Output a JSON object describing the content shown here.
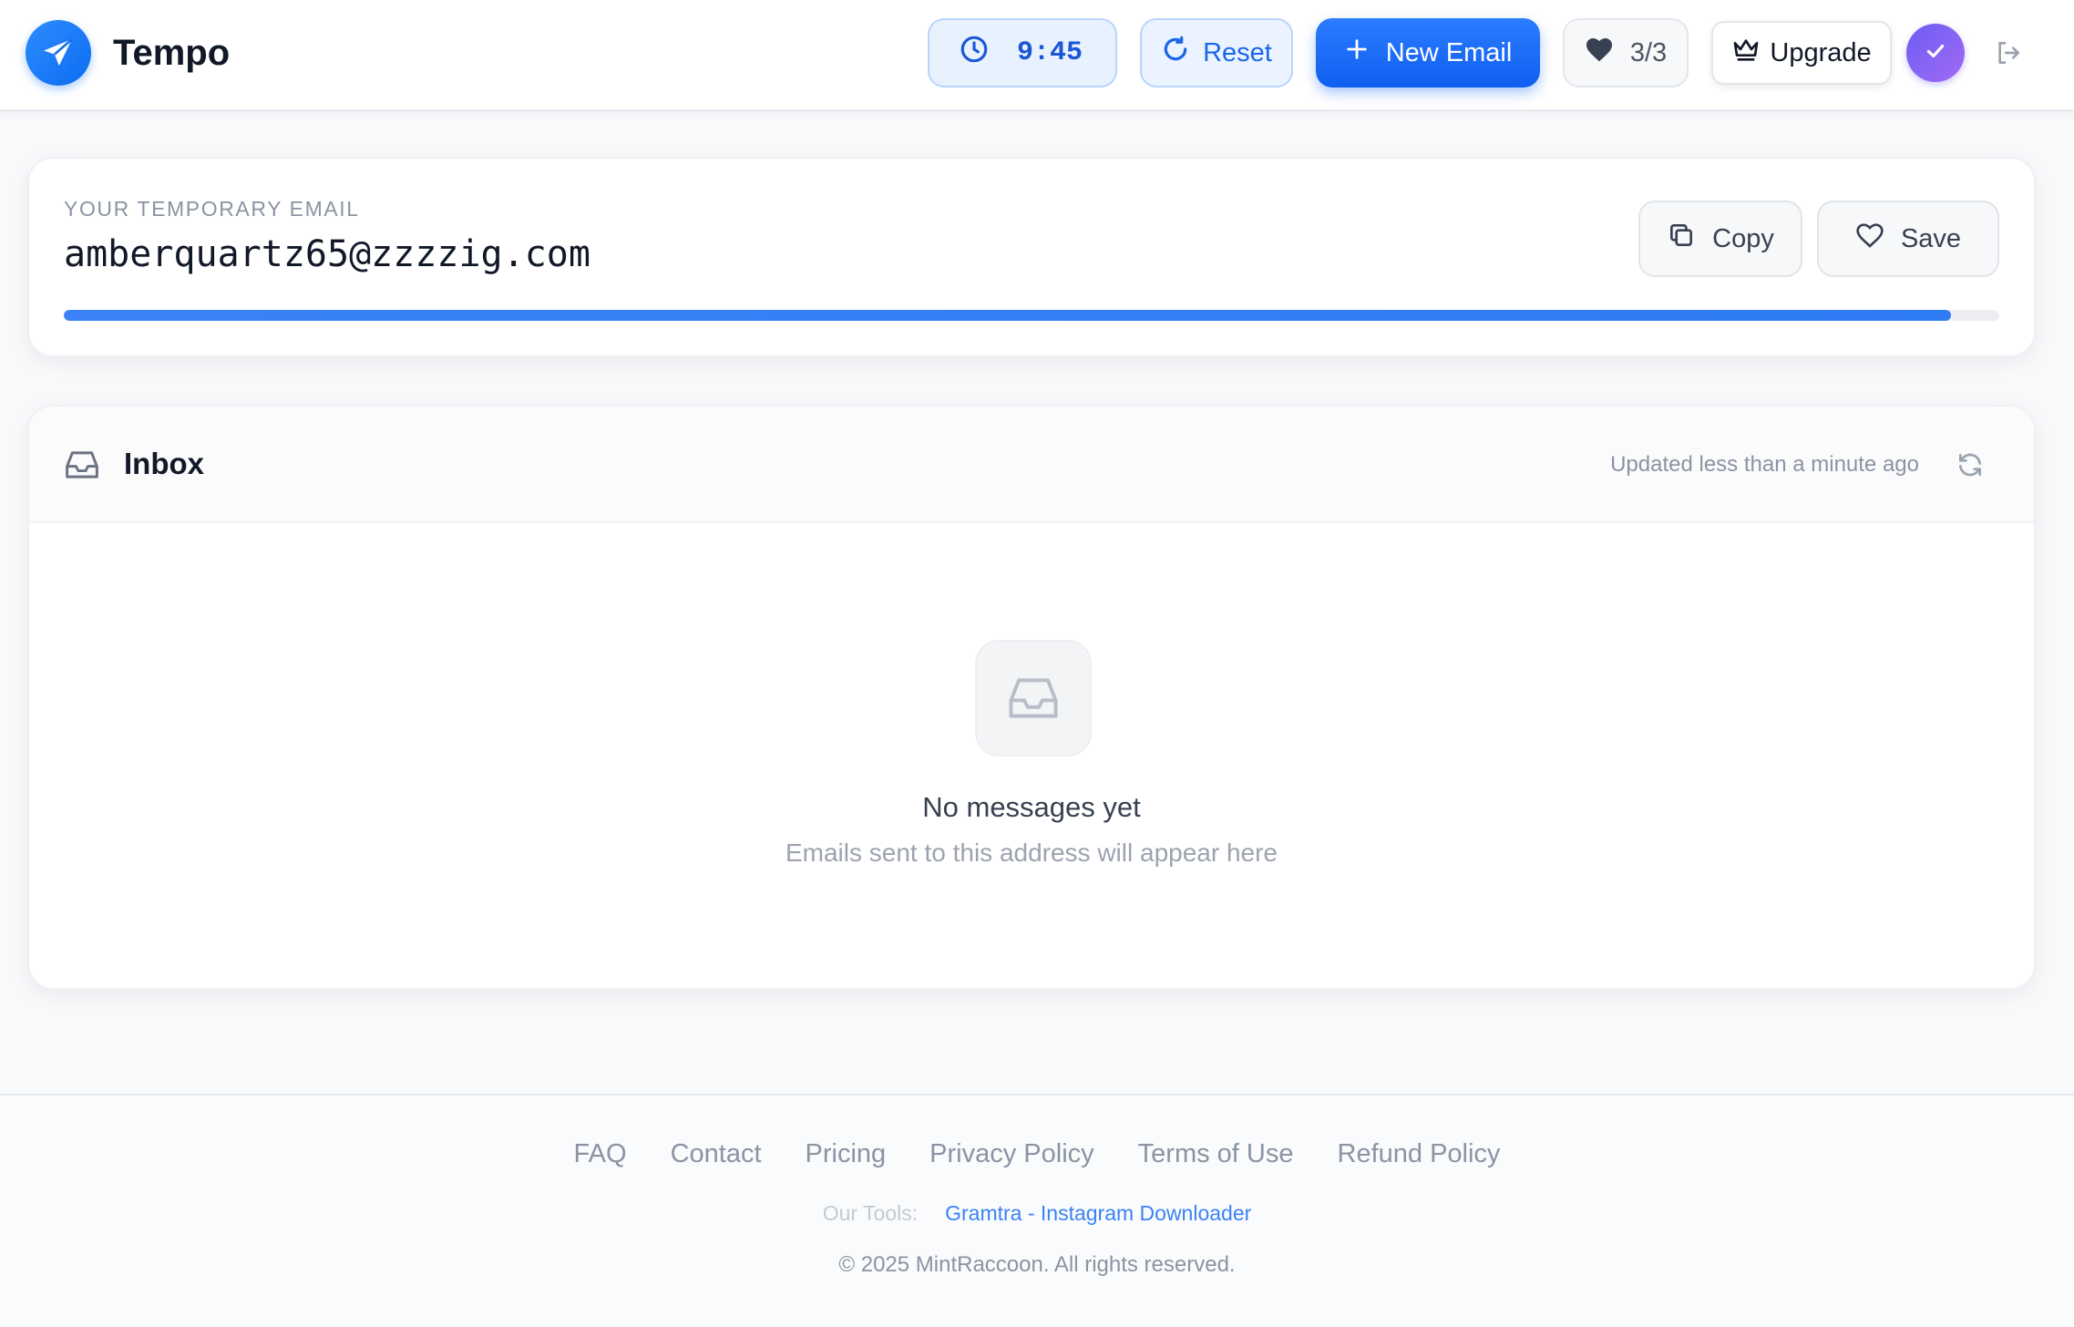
{
  "header": {
    "brand": "Tempo",
    "timer": "9:45",
    "reset_label": "Reset",
    "new_email_label": "New Email",
    "favorites_count": "3/3",
    "upgrade_label": "Upgrade",
    "icons": {
      "logo": "paper-plane-icon",
      "timer": "clock-icon",
      "reset": "rotate-icon",
      "new": "plus-icon",
      "favorites": "heart-icon",
      "upgrade": "crown-icon",
      "avatar": "check-icon",
      "logout": "logout-icon"
    }
  },
  "email_card": {
    "label": "YOUR TEMPORARY EMAIL",
    "address": "amberquartz65@zzzzig.com",
    "copy_label": "Copy",
    "save_label": "Save",
    "time_remaining_fraction": 0.975
  },
  "inbox": {
    "title": "Inbox",
    "updated_text": "Updated less than a minute ago",
    "empty_title": "No messages yet",
    "empty_subtitle": "Emails sent to this address will appear here"
  },
  "footer": {
    "links": [
      "FAQ",
      "Contact",
      "Pricing",
      "Privacy Policy",
      "Terms of Use",
      "Refund Policy"
    ],
    "tools_label": "Our Tools:",
    "tools_link": "Gramtra - Instagram Downloader",
    "copyright": "© 2025 MintRaccoon. All rights reserved."
  },
  "colors": {
    "accent": "#1a66e8",
    "primary_button": "#0f5ff0",
    "avatar": "#8b5cf6",
    "progress": "#3b82f6"
  }
}
